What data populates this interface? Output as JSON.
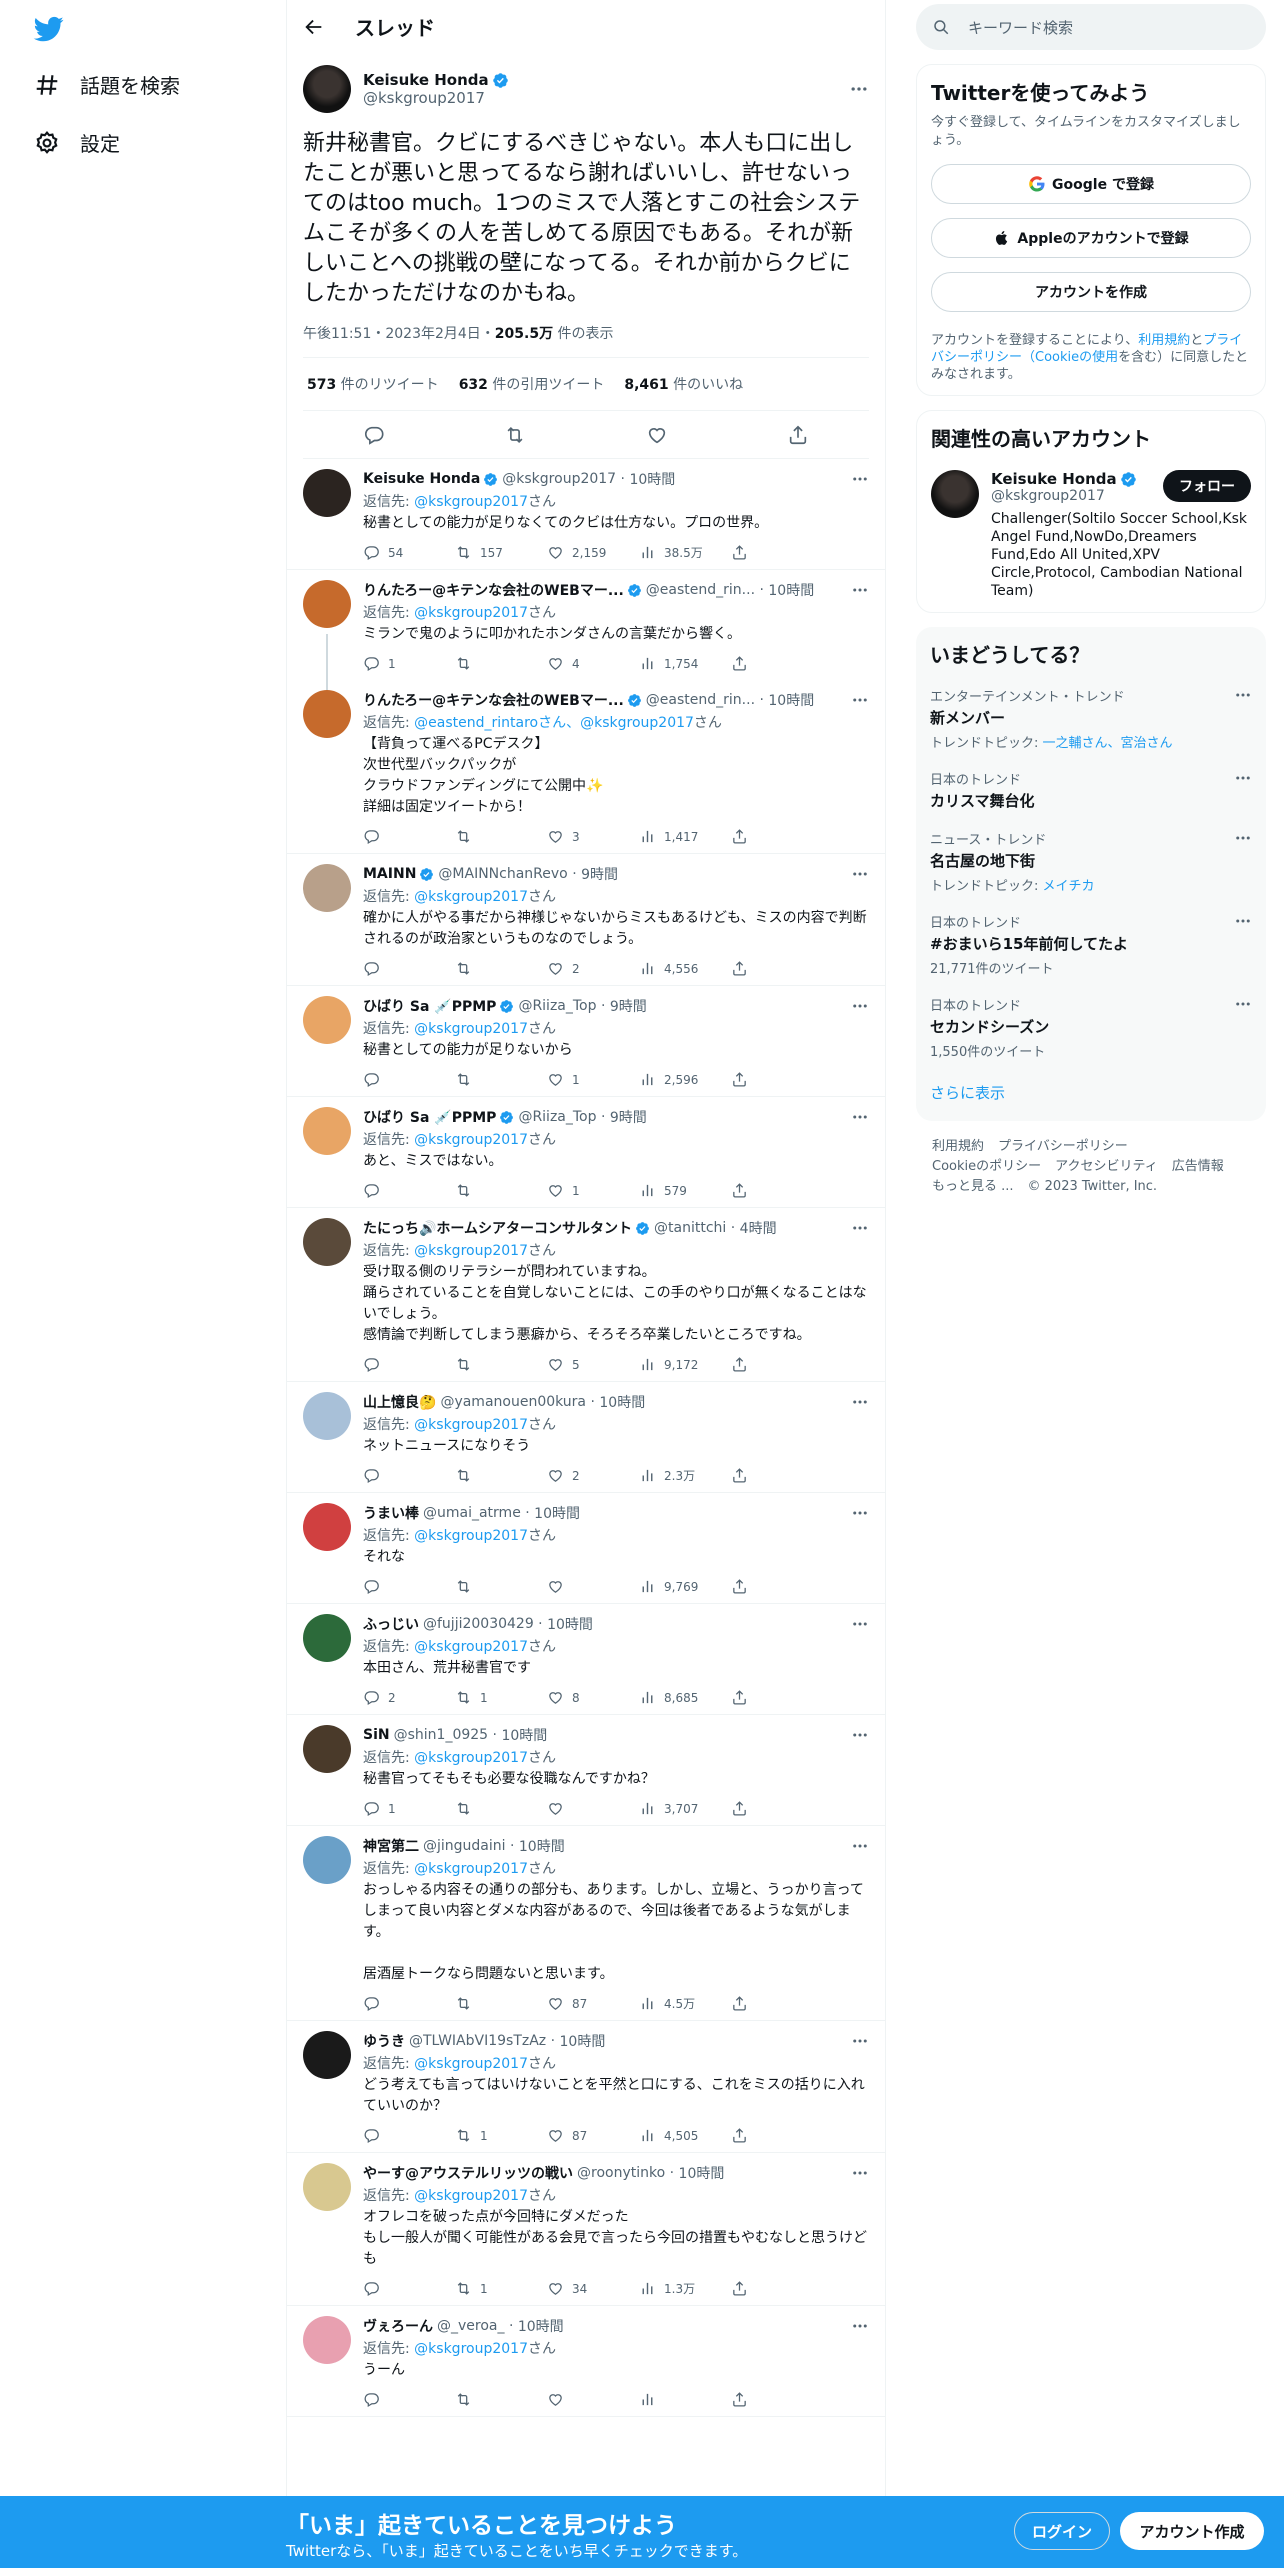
{
  "nav": {
    "explore": "話題を検索",
    "settings": "設定"
  },
  "header": {
    "title": "スレッド"
  },
  "main_tweet": {
    "name": "Keisuke Honda",
    "handle": "@kskgroup2017",
    "text": "新井秘書官。クビにするべきじゃない。本人も口に出したことが悪いと思ってるなら謝ればいいし、許せないってのはtoo much。1つのミスで人落とすこの社会システムこそが多くの人を苦しめてる原因でもある。それが新しいことへの挑戦の壁になってる。それか前からクビにしたかっただけなのかもね。",
    "time": "午後11:51・2023年2月4日・",
    "views": "205.5万",
    "views_label": " 件の表示",
    "retweets": "573",
    "retweets_label": " 件のリツイート",
    "quotes": "632",
    "quotes_label": " 件の引用ツイート",
    "likes": "8,461",
    "likes_label": " 件のいいね"
  },
  "reply_prefix": "返信先: ",
  "reply_suffix": "さん",
  "replies": [
    {
      "name": "Keisuke Honda",
      "handle": "@kskgroup2017",
      "time": "10時間",
      "verified": true,
      "reply_to": "@kskgroup2017",
      "text": "秘書としての能力が足りなくてのクビは仕方ない。プロの世界。",
      "replies": "54",
      "retweets": "157",
      "likes": "2,159",
      "views": "38.5万"
    },
    {
      "name": "りんたろー@キテンな会社のWEBマー...",
      "handle": "@eastend_rin...",
      "time": "10時間",
      "verified": true,
      "reply_to": "@kskgroup2017",
      "text": "ミランで鬼のように叩かれたホンダさんの言葉だから響く。",
      "replies": "1",
      "retweets": "",
      "likes": "4",
      "views": "1,754"
    },
    {
      "name": "りんたろー@キテンな会社のWEBマー...",
      "handle": "@eastend_rin...",
      "time": "10時間",
      "verified": true,
      "reply_to": "@eastend_rintaroさん、@kskgroup2017",
      "text": "【背負って運べるPCデスク】\n次世代型バックパックが\nクラウドファンディングにて公開中✨\n詳細は固定ツイートから！",
      "replies": "",
      "retweets": "",
      "likes": "3",
      "views": "1,417"
    },
    {
      "name": "MAINN",
      "handle": "@MAINNchanRevo",
      "time": "9時間",
      "verified": true,
      "reply_to": "@kskgroup2017",
      "text": "確かに人がやる事だから神様じゃないからミスもあるけども、ミスの内容で判断されるのが政治家というものなのでしょう。",
      "replies": "",
      "retweets": "",
      "likes": "2",
      "views": "4,556"
    },
    {
      "name": "ひばり Sa 💉PPMP",
      "handle": "@Riiza_Top",
      "time": "9時間",
      "verified": true,
      "reply_to": "@kskgroup2017",
      "text": "秘書としての能力が足りないから",
      "replies": "",
      "retweets": "",
      "likes": "1",
      "views": "2,596"
    },
    {
      "name": "ひばり Sa 💉PPMP",
      "handle": "@Riiza_Top",
      "time": "9時間",
      "verified": true,
      "reply_to": "@kskgroup2017",
      "text": "あと、ミスではない。",
      "replies": "",
      "retweets": "",
      "likes": "1",
      "views": "579"
    },
    {
      "name": "たにっち🔊ホームシアターコンサルタント",
      "handle": "@tanittchi",
      "time": "4時間",
      "verified": true,
      "reply_to": "@kskgroup2017",
      "text": "受け取る側のリテラシーが問われていますね。\n踊らされていることを自覚しないことには、この手のやり口が無くなることはないでしょう。\n感情論で判断してしまう悪癖から、そろそろ卒業したいところですね。",
      "replies": "",
      "retweets": "",
      "likes": "5",
      "views": "9,172"
    },
    {
      "name": "山上憶良🤔",
      "handle": "@yamanouen00kura",
      "time": "10時間",
      "verified": false,
      "reply_to": "@kskgroup2017",
      "text": "ネットニュースになりそう",
      "replies": "",
      "retweets": "",
      "likes": "2",
      "views": "2.3万"
    },
    {
      "name": "うまい棒",
      "handle": "@umai_atrme",
      "time": "10時間",
      "verified": false,
      "reply_to": "@kskgroup2017",
      "text": "それな",
      "replies": "",
      "retweets": "",
      "likes": "",
      "views": "9,769"
    },
    {
      "name": "ふっじい",
      "handle": "@fujji20030429",
      "time": "10時間",
      "verified": false,
      "reply_to": "@kskgroup2017",
      "text": "本田さん、荒井秘書官です",
      "replies": "2",
      "retweets": "1",
      "likes": "8",
      "views": "8,685"
    },
    {
      "name": "SiN",
      "handle": "@shin1_0925",
      "time": "10時間",
      "verified": false,
      "reply_to": "@kskgroup2017",
      "text": "秘書官ってそもそも必要な役職なんですかね？",
      "replies": "1",
      "retweets": "",
      "likes": "",
      "views": "3,707"
    },
    {
      "name": "神宮第二",
      "handle": "@jingudaini",
      "time": "10時間",
      "verified": false,
      "reply_to": "@kskgroup2017",
      "text": "おっしゃる内容その通りの部分も、あります。しかし、立場と、うっかり言ってしまって良い内容とダメな内容があるので、今回は後者であるような気がします。\n\n居酒屋トークなら問題ないと思います。",
      "replies": "",
      "retweets": "",
      "likes": "87",
      "views": "4.5万"
    },
    {
      "name": "ゆうき",
      "handle": "@TLWIAbVI19sTzAz",
      "time": "10時間",
      "verified": false,
      "reply_to": "@kskgroup2017",
      "text": "どう考えても言ってはいけないことを平然と口にする、これをミスの括りに入れていいのか？",
      "replies": "",
      "retweets": "1",
      "likes": "87",
      "views": "4,505"
    },
    {
      "name": "やーす@アウステルリッツの戦い",
      "handle": "@roonytinko",
      "time": "10時間",
      "verified": false,
      "reply_to": "@kskgroup2017",
      "text": "オフレコを破った点が今回特にダメだった\nもし一般人が聞く可能性がある会見で言ったら今回の措置もやむなしと思うけども",
      "replies": "",
      "retweets": "1",
      "likes": "34",
      "views": "1.3万"
    },
    {
      "name": "ヴぇろーん",
      "handle": "@_veroa_",
      "time": "10時間",
      "verified": false,
      "reply_to": "@kskgroup2017",
      "text": "うーん",
      "replies": "",
      "retweets": "",
      "likes": "",
      "views": ""
    }
  ],
  "search": {
    "placeholder": "キーワード検索"
  },
  "signup": {
    "title": "Twitterを使ってみよう",
    "subtitle": "今すぐ登録して、タイムラインをカスタマイズしましょう。",
    "google": "Google で登録",
    "apple": "Appleのアカウントで登録",
    "create": "アカウントを作成",
    "legal_1": "アカウントを登録することにより、",
    "legal_terms": "利用規約",
    "legal_and": "と",
    "legal_privacy": "プライバシーポリシー（Cookieの使用",
    "legal_2": "を含む）に同意したとみなされます。"
  },
  "related": {
    "title": "関連性の高いアカウント",
    "name": "Keisuke Honda",
    "handle": "@kskgroup2017",
    "follow": "フォロー",
    "bio": "Challenger(Soltilo Soccer School,Ksk Angel Fund,NowDo,Dreamers Fund,Edo All United,XPV Circle,Protocol, Cambodian National Team)"
  },
  "trends": {
    "title": "いまどうしてる？",
    "items": [
      {
        "category": "エンターテインメント・トレンド",
        "name": "新メンバー",
        "sub_label": "トレンドトピック: ",
        "sub_link": "一之輔さん、宮治さん"
      },
      {
        "category": "日本のトレンド",
        "name": "カリスマ舞台化",
        "sub_label": "",
        "sub_link": ""
      },
      {
        "category": "ニュース・トレンド",
        "name": "名古屋の地下街",
        "sub_label": "トレンドトピック: ",
        "sub_link": "メイチカ"
      },
      {
        "category": "日本のトレンド",
        "name": "#おまいら15年前何してたよ",
        "sub_label": "21,771件のツイート",
        "sub_link": ""
      },
      {
        "category": "日本のトレンド",
        "name": "セカンドシーズン",
        "sub_label": "1,550件のツイート",
        "sub_link": ""
      }
    ],
    "show_more": "さらに表示"
  },
  "footer": {
    "terms": "利用規約",
    "privacy": "プライバシーポリシー",
    "cookie": "Cookieのポリシー",
    "accessibility": "アクセシビリティ",
    "ads": "広告情報",
    "more": "もっと見る ...",
    "copyright": "© 2023 Twitter, Inc."
  },
  "bottom_bar": {
    "title": "「いま」起きていることを見つけよう",
    "subtitle": "Twitterなら、「いま」起きていることをいち早くチェックできます。",
    "login": "ログイン",
    "signup": "アカウント作成"
  },
  "colors": {
    "accent": "#1d9bf0",
    "text": "#0f1419",
    "secondary": "#536471"
  }
}
